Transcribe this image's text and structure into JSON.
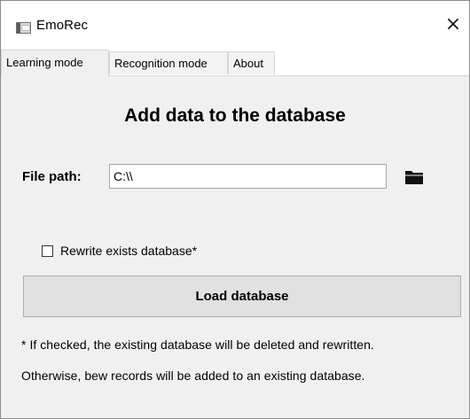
{
  "window": {
    "title": "EmoRec",
    "close_glyph": "×"
  },
  "tabs": [
    {
      "label": "Learning mode",
      "active": true
    },
    {
      "label": "Recognition mode",
      "active": false
    },
    {
      "label": "About",
      "active": false
    }
  ],
  "learning": {
    "heading": "Add data to the database",
    "file_path_label": "File path:",
    "file_path_value": "C:\\\\",
    "browse_icon": "folder-icon",
    "rewrite_checkbox_label": "Rewrite exists database*",
    "rewrite_checked": false,
    "load_button_label": "Load database",
    "note_line1": "* If checked, the existing database will be deleted and rewritten.",
    "note_line2": "Otherwise, bew records will be added to an existing database."
  }
}
